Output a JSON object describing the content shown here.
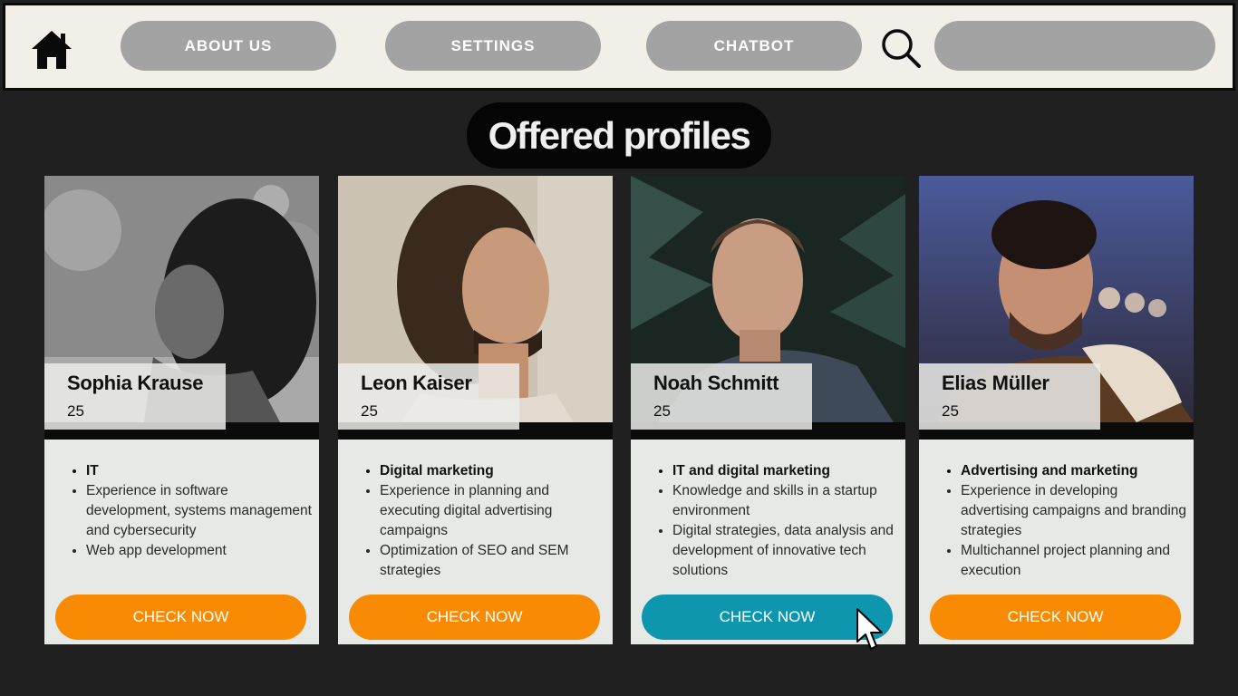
{
  "nav": {
    "about_label": "ABOUT US",
    "settings_label": "SETTINGS",
    "chatbot_label": "CHATBOT",
    "search_placeholder": "",
    "search_value": ""
  },
  "icons": {
    "home": "home-icon",
    "search": "search-icon",
    "cursor": "cursor-icon"
  },
  "page": {
    "title": "Offered profiles"
  },
  "profiles": [
    {
      "name": "Sophia Krause",
      "age": "25",
      "field": "IT",
      "points": [
        "Experience in software development, systems management and cybersecurity",
        "Web app development"
      ],
      "button": "CHECK NOW"
    },
    {
      "name": "Leon Kaiser",
      "age": "25",
      "field": "Digital marketing",
      "points": [
        "Experience in planning and executing digital advertising campaigns",
        "Optimization of SEO and SEM strategies"
      ],
      "button": "CHECK NOW"
    },
    {
      "name": "Noah Schmitt",
      "age": "25",
      "field": "IT and digital marketing",
      "points": [
        "Knowledge and skills in a startup environment",
        "Digital strategies, data analysis and development of innovative tech solutions"
      ],
      "button": "CHECK NOW"
    },
    {
      "name": "Elias Müller",
      "age": "25",
      "field": "Advertising and marketing",
      "points": [
        "Experience in developing advertising campaigns and branding strategies",
        "Multichannel project planning and execution"
      ],
      "button": "CHECK NOW"
    }
  ],
  "colors": {
    "button_default": "#f98b04",
    "button_active": "#0d96ad",
    "nav_button": "#a3a3a3",
    "background": "#202020"
  }
}
